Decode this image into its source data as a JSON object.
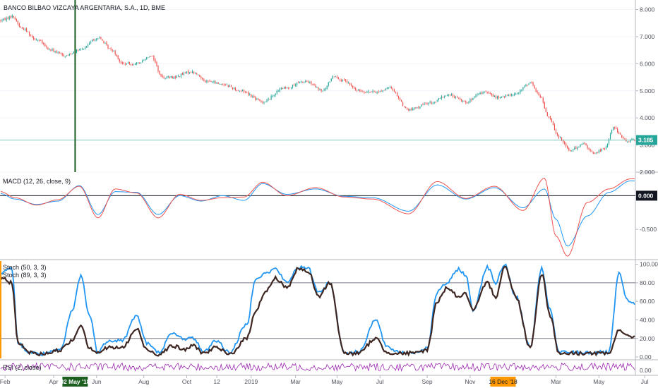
{
  "chart_data": [
    {
      "type": "candlestick",
      "title": "BANCO BILBAO VIZCAYA ARGENTARIA, S.A., 1D, BME",
      "ylim": [
        2.0,
        8.3
      ],
      "yticks": [
        "2.000",
        "3.000",
        "4.000",
        "5.000",
        "6.000",
        "7.000",
        "8.000"
      ],
      "last_price": "3.185",
      "last_price_color": "#26a69a",
      "up_color": "#26a69a",
      "down_color": "#ef5350",
      "anchors": [
        [
          0,
          7.6
        ],
        [
          8,
          7.75
        ],
        [
          15,
          7.3
        ],
        [
          25,
          6.9
        ],
        [
          35,
          6.5
        ],
        [
          45,
          6.3
        ],
        [
          55,
          6.5
        ],
        [
          68,
          6.95
        ],
        [
          78,
          6.5
        ],
        [
          85,
          6.0
        ],
        [
          95,
          6.0
        ],
        [
          105,
          6.3
        ],
        [
          113,
          5.5
        ],
        [
          120,
          5.5
        ],
        [
          133,
          5.7
        ],
        [
          145,
          5.35
        ],
        [
          155,
          5.25
        ],
        [
          168,
          5.0
        ],
        [
          183,
          4.6
        ],
        [
          198,
          5.1
        ],
        [
          213,
          5.35
        ],
        [
          225,
          5.0
        ],
        [
          233,
          5.55
        ],
        [
          240,
          5.35
        ],
        [
          250,
          5.0
        ],
        [
          262,
          4.95
        ],
        [
          272,
          5.1
        ],
        [
          285,
          4.3
        ],
        [
          300,
          4.55
        ],
        [
          313,
          4.85
        ],
        [
          325,
          4.6
        ],
        [
          338,
          4.95
        ],
        [
          348,
          4.75
        ],
        [
          360,
          4.9
        ],
        [
          370,
          5.3
        ],
        [
          377,
          4.8
        ],
        [
          382,
          4.1
        ],
        [
          390,
          3.3
        ],
        [
          398,
          2.8
        ],
        [
          407,
          3.05
        ],
        [
          414,
          2.7
        ],
        [
          422,
          2.85
        ],
        [
          428,
          3.65
        ],
        [
          437,
          3.15
        ],
        [
          442,
          3.2
        ]
      ],
      "grid": true
    },
    {
      "type": "line",
      "title": "MACD (12, 26, close, 9)",
      "ylim": [
        -0.95,
        0.35
      ],
      "yticks": [
        "-0.500"
      ],
      "last_value": "0.000",
      "series": [
        {
          "color": "#2196f3",
          "values": [
            [
              0,
              0.03
            ],
            [
              10,
              -0.05
            ],
            [
              25,
              -0.13
            ],
            [
              40,
              -0.08
            ],
            [
              55,
              0.15
            ],
            [
              68,
              -0.28
            ],
            [
              80,
              0.06
            ],
            [
              95,
              0.05
            ],
            [
              110,
              -0.28
            ],
            [
              125,
              0.0
            ],
            [
              140,
              -0.08
            ],
            [
              155,
              0.0
            ],
            [
              170,
              -0.07
            ],
            [
              183,
              0.18
            ],
            [
              200,
              0.02
            ],
            [
              220,
              0.1
            ],
            [
              240,
              -0.01
            ],
            [
              260,
              -0.03
            ],
            [
              285,
              -0.23
            ],
            [
              305,
              0.16
            ],
            [
              325,
              -0.05
            ],
            [
              345,
              0.12
            ],
            [
              365,
              -0.18
            ],
            [
              380,
              0.1
            ],
            [
              388,
              -0.35
            ],
            [
              396,
              -0.75
            ],
            [
              410,
              -0.3
            ],
            [
              425,
              0.05
            ],
            [
              440,
              0.22
            ]
          ]
        },
        {
          "color": "#ef5350",
          "values": [
            [
              0,
              0.06
            ],
            [
              10,
              -0.03
            ],
            [
              25,
              -0.14
            ],
            [
              40,
              -0.06
            ],
            [
              55,
              0.14
            ],
            [
              68,
              -0.33
            ],
            [
              80,
              0.1
            ],
            [
              95,
              0.04
            ],
            [
              110,
              -0.33
            ],
            [
              125,
              0.02
            ],
            [
              140,
              -0.07
            ],
            [
              155,
              -0.03
            ],
            [
              170,
              -0.02
            ],
            [
              183,
              0.2
            ],
            [
              200,
              0.0
            ],
            [
              220,
              0.12
            ],
            [
              240,
              -0.02
            ],
            [
              260,
              -0.05
            ],
            [
              285,
              -0.27
            ],
            [
              305,
              0.21
            ],
            [
              325,
              -0.04
            ],
            [
              345,
              0.14
            ],
            [
              365,
              -0.22
            ],
            [
              380,
              0.26
            ],
            [
              388,
              -0.6
            ],
            [
              396,
              -0.9
            ],
            [
              410,
              -0.1
            ],
            [
              425,
              0.1
            ],
            [
              440,
              0.25
            ]
          ]
        }
      ]
    },
    {
      "type": "line",
      "title": "Stoch (50, 3, 3)",
      "subtitle": "Stoch (89, 3, 3)",
      "ylim": [
        -3,
        105
      ],
      "yticks": [
        "0.00",
        "20.00",
        "40.00",
        "60.00",
        "80.00",
        "100.00"
      ],
      "bands": [
        20,
        80
      ],
      "series": [
        {
          "color": "#2196f3",
          "values": [
            [
              0,
              90
            ],
            [
              8,
              95
            ],
            [
              12,
              15
            ],
            [
              20,
              5
            ],
            [
              28,
              3
            ],
            [
              35,
              5
            ],
            [
              42,
              8
            ],
            [
              50,
              50
            ],
            [
              56,
              88
            ],
            [
              62,
              45
            ],
            [
              68,
              5
            ],
            [
              75,
              18
            ],
            [
              85,
              18
            ],
            [
              95,
              45
            ],
            [
              102,
              15
            ],
            [
              110,
              5
            ],
            [
              120,
              25
            ],
            [
              128,
              20
            ],
            [
              135,
              20
            ],
            [
              142,
              5
            ],
            [
              150,
              18
            ],
            [
              160,
              5
            ],
            [
              172,
              35
            ],
            [
              178,
              85
            ],
            [
              185,
              90
            ],
            [
              192,
              95
            ],
            [
              200,
              80
            ],
            [
              208,
              97
            ],
            [
              215,
              95
            ],
            [
              222,
              70
            ],
            [
              230,
              80
            ],
            [
              240,
              5
            ],
            [
              250,
              5
            ],
            [
              262,
              40
            ],
            [
              270,
              10
            ],
            [
              280,
              5
            ],
            [
              290,
              5
            ],
            [
              298,
              10
            ],
            [
              305,
              70
            ],
            [
              312,
              80
            ],
            [
              320,
              95
            ],
            [
              325,
              88
            ],
            [
              330,
              50
            ],
            [
              340,
              97
            ],
            [
              346,
              80
            ],
            [
              352,
              100
            ],
            [
              360,
              65
            ],
            [
              370,
              10
            ],
            [
              378,
              95
            ],
            [
              384,
              50
            ],
            [
              390,
              5
            ],
            [
              400,
              5
            ],
            [
              410,
              5
            ],
            [
              418,
              5
            ],
            [
              425,
              5
            ],
            [
              432,
              90
            ],
            [
              438,
              60
            ],
            [
              442,
              58
            ]
          ]
        },
        {
          "color": "#3e2723",
          "values": [
            [
              0,
              85
            ],
            [
              8,
              80
            ],
            [
              12,
              15
            ],
            [
              20,
              5
            ],
            [
              28,
              3
            ],
            [
              35,
              5
            ],
            [
              42,
              8
            ],
            [
              50,
              18
            ],
            [
              56,
              35
            ],
            [
              62,
              10
            ],
            [
              68,
              5
            ],
            [
              75,
              10
            ],
            [
              85,
              10
            ],
            [
              95,
              30
            ],
            [
              102,
              8
            ],
            [
              110,
              3
            ],
            [
              120,
              12
            ],
            [
              128,
              8
            ],
            [
              135,
              12
            ],
            [
              142,
              4
            ],
            [
              150,
              10
            ],
            [
              160,
              3
            ],
            [
              172,
              20
            ],
            [
              178,
              50
            ],
            [
              185,
              70
            ],
            [
              192,
              85
            ],
            [
              200,
              75
            ],
            [
              208,
              95
            ],
            [
              215,
              92
            ],
            [
              222,
              65
            ],
            [
              230,
              80
            ],
            [
              240,
              4
            ],
            [
              250,
              4
            ],
            [
              262,
              20
            ],
            [
              270,
              5
            ],
            [
              280,
              4
            ],
            [
              290,
              4
            ],
            [
              298,
              8
            ],
            [
              305,
              60
            ],
            [
              312,
              75
            ],
            [
              320,
              65
            ],
            [
              325,
              68
            ],
            [
              330,
              50
            ],
            [
              340,
              80
            ],
            [
              346,
              65
            ],
            [
              352,
              98
            ],
            [
              360,
              65
            ],
            [
              370,
              10
            ],
            [
              378,
              90
            ],
            [
              384,
              45
            ],
            [
              390,
              4
            ],
            [
              400,
              4
            ],
            [
              410,
              4
            ],
            [
              418,
              4
            ],
            [
              425,
              3
            ],
            [
              432,
              30
            ],
            [
              438,
              22
            ],
            [
              442,
              22
            ]
          ]
        }
      ]
    },
    {
      "type": "line",
      "title": "RSI (2, close)",
      "last_value": "0.00",
      "series": [
        {
          "color": "#9c27b0"
        }
      ]
    }
  ],
  "x_axis": {
    "ticks": [
      {
        "label": "Feb",
        "i": 3
      },
      {
        "label": "Apr",
        "i": 37
      },
      {
        "label": "Jun",
        "i": 67
      },
      {
        "label": "Aug",
        "i": 100
      },
      {
        "label": "Oct",
        "i": 130
      },
      {
        "label": "12",
        "i": 151
      },
      {
        "label": "2019",
        "i": 175
      },
      {
        "label": "Mar",
        "i": 206
      },
      {
        "label": "May",
        "i": 235
      },
      {
        "label": "Jul",
        "i": 265
      },
      {
        "label": "Sep",
        "i": 298
      },
      {
        "label": "Nov",
        "i": 328
      },
      {
        "label": "Mar",
        "i": 388
      },
      {
        "label": "May",
        "i": 418
      },
      {
        "label": "Jul",
        "i": 450
      }
    ],
    "n_bars": 444,
    "cursor_label": "02 May '18",
    "cursor_index": 52,
    "cursor_color": "#1b5e20",
    "highlight_label": "16 Dec '18",
    "highlight_index": 351,
    "highlight_color": "#ff9800"
  }
}
